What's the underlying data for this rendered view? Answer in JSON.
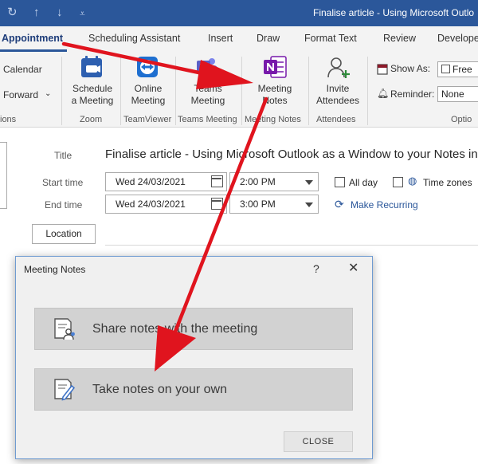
{
  "window": {
    "title": "Finalise article - Using Microsoft Outlo",
    "qat": {
      "sync_icon": "refresh-icon",
      "up_icon": "arrow-up-icon",
      "down_icon": "arrow-down-icon",
      "customize_icon": "customize-qat-icon"
    }
  },
  "ribbon": {
    "tabs": [
      {
        "label": "Appointment",
        "active": true
      },
      {
        "label": "Scheduling Assistant"
      },
      {
        "label": "Insert"
      },
      {
        "label": "Draw"
      },
      {
        "label": "Format Text"
      },
      {
        "label": "Review"
      },
      {
        "label": "Develope"
      }
    ],
    "actions": {
      "calendar": "Calendar",
      "forward": "Forward",
      "actions_group": "ions"
    },
    "schedule_meeting": {
      "line1": "Schedule",
      "line2": "a Meeting",
      "group": "Zoom"
    },
    "online_meeting": {
      "line1": "Online",
      "line2": "Meeting",
      "group": "TeamViewer"
    },
    "teams_meeting": {
      "line1": "Teams",
      "line2": "Meeting",
      "group": "Teams Meeting"
    },
    "meeting_notes": {
      "line1": "Meeting",
      "line2": "Notes",
      "group": "Meeting Notes"
    },
    "invite_attendees": {
      "line1": "Invite",
      "line2": "Attendees",
      "group": "Attendees"
    },
    "options": {
      "show_as_label": "Show As:",
      "show_as_value": "Free",
      "reminder_label": "Reminder:",
      "reminder_value": "None",
      "group": "Optio"
    },
    "colors": {
      "accent": "#2b579a",
      "onenote": "#7719aa",
      "teams": "#5b5fc7",
      "arrow": "#e0141e"
    }
  },
  "form": {
    "title_label": "Title",
    "title_value": "Finalise article - Using Microsoft Outlook as a Window to your Notes in",
    "start_label": "Start time",
    "start_date": "Wed 24/03/2021",
    "start_time": "2:00 PM",
    "end_label": "End time",
    "end_date": "Wed 24/03/2021",
    "end_time": "3:00 PM",
    "all_day": "All day",
    "time_zones": "Time zones",
    "make_recurring": "Make Recurring",
    "location": "Location"
  },
  "dialog": {
    "title": "Meeting Notes",
    "help": "?",
    "close_glyph": "✕",
    "option1": "Share notes with the meeting",
    "option2": "Take notes on your own",
    "close_button": "CLOSE"
  }
}
